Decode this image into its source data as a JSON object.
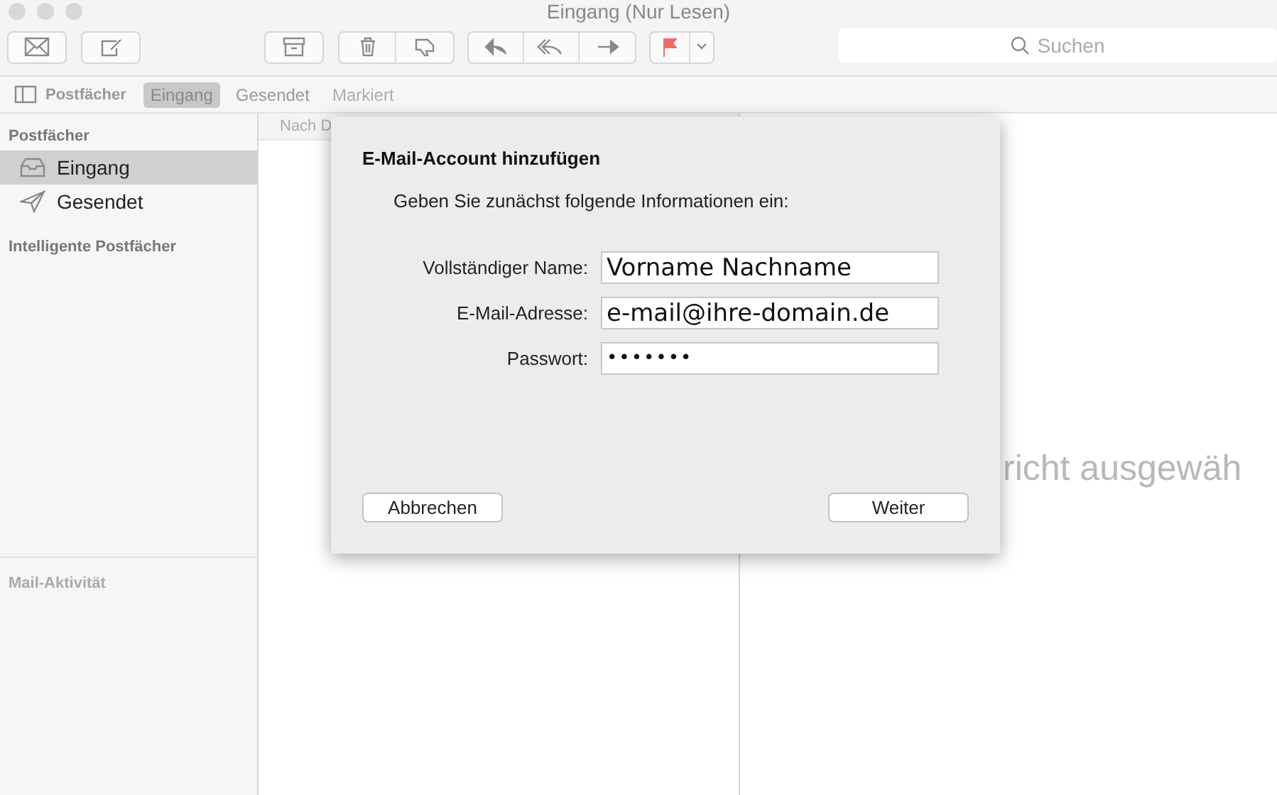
{
  "window": {
    "title": "Eingang (Nur Lesen)"
  },
  "toolbar": {
    "search": {
      "placeholder": "Suchen"
    }
  },
  "favorites_bar": {
    "label": "Postfächer",
    "items": [
      {
        "label": "Eingang",
        "selected": true,
        "disabled": false
      },
      {
        "label": "Gesendet",
        "selected": false,
        "disabled": false
      },
      {
        "label": "Markiert",
        "selected": false,
        "disabled": true
      }
    ]
  },
  "sidebar": {
    "heading": "Postfächer",
    "items": [
      {
        "label": "Eingang",
        "kind": "inbox",
        "selected": true
      },
      {
        "label": "Gesendet",
        "kind": "sent",
        "selected": false
      }
    ],
    "smart_heading": "Intelligente Postfächer",
    "activity_heading": "Mail-Aktivität"
  },
  "message_list": {
    "column_1": "Nach D"
  },
  "viewer": {
    "text": "richt ausgewäh"
  },
  "dialog": {
    "title": "E-Mail-Account hinzufügen",
    "intro": "Geben Sie zunächst folgende Informationen ein:",
    "fields": [
      {
        "label": "Vollständiger Name:",
        "value": "Vorname Nachname",
        "kind": "text"
      },
      {
        "label": "E-Mail-Adresse:",
        "value": "e-mail@ihre-domain.de",
        "kind": "text"
      },
      {
        "label": "Passwort:",
        "value": "•••••••",
        "kind": "password"
      }
    ],
    "buttons": [
      "Abbrechen",
      "Weiter"
    ]
  }
}
